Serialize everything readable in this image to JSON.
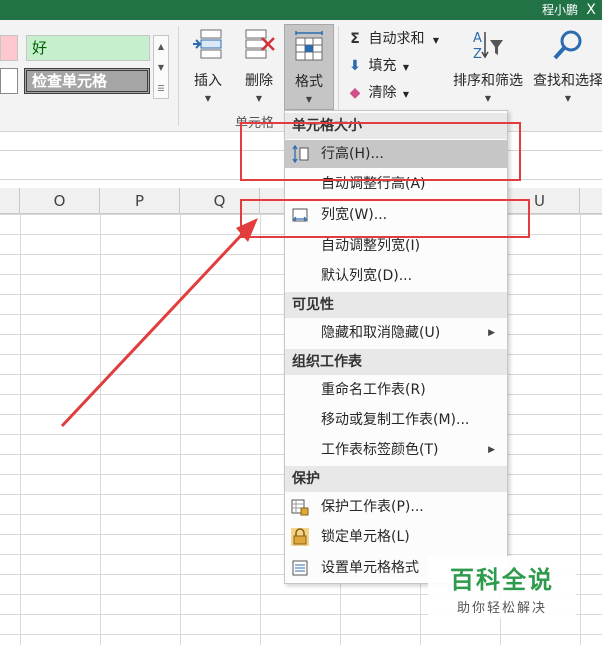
{
  "titlebar": {
    "user": "程小鹏",
    "close": "X"
  },
  "styles": {
    "good": "好",
    "check_cell": "检查单元格"
  },
  "cells_group": {
    "insert": "插入",
    "delete": "删除",
    "format": "格式",
    "label": "单元格"
  },
  "editing": {
    "autosum": "自动求和",
    "fill": "填充",
    "clear": "清除",
    "sort_filter": "排序和筛选",
    "find_select": "查找和选择"
  },
  "columns": [
    "O",
    "P",
    "Q",
    "U"
  ],
  "menu": {
    "sections": {
      "cell_size": "单元格大小",
      "visibility": "可见性",
      "organize": "组织工作表",
      "protection": "保护"
    },
    "items": {
      "row_height": "行高(H)...",
      "autofit_row": "自动调整行高(A)",
      "col_width": "列宽(W)...",
      "autofit_col": "自动调整列宽(I)",
      "default_width": "默认列宽(D)...",
      "hide_unhide": "隐藏和取消隐藏(U)",
      "rename_sheet": "重命名工作表(R)",
      "move_copy": "移动或复制工作表(M)...",
      "tab_color": "工作表标签颜色(T)",
      "protect_sheet": "保护工作表(P)...",
      "lock_cell": "锁定单元格(L)",
      "format_cells": "设置单元格格式"
    }
  },
  "watermark": {
    "title": "百科全说",
    "subtitle": "助你轻松解决"
  },
  "colors": {
    "excel_green": "#217346",
    "annotation_red": "#e23c3c",
    "highlight": "#c6c6c6"
  }
}
